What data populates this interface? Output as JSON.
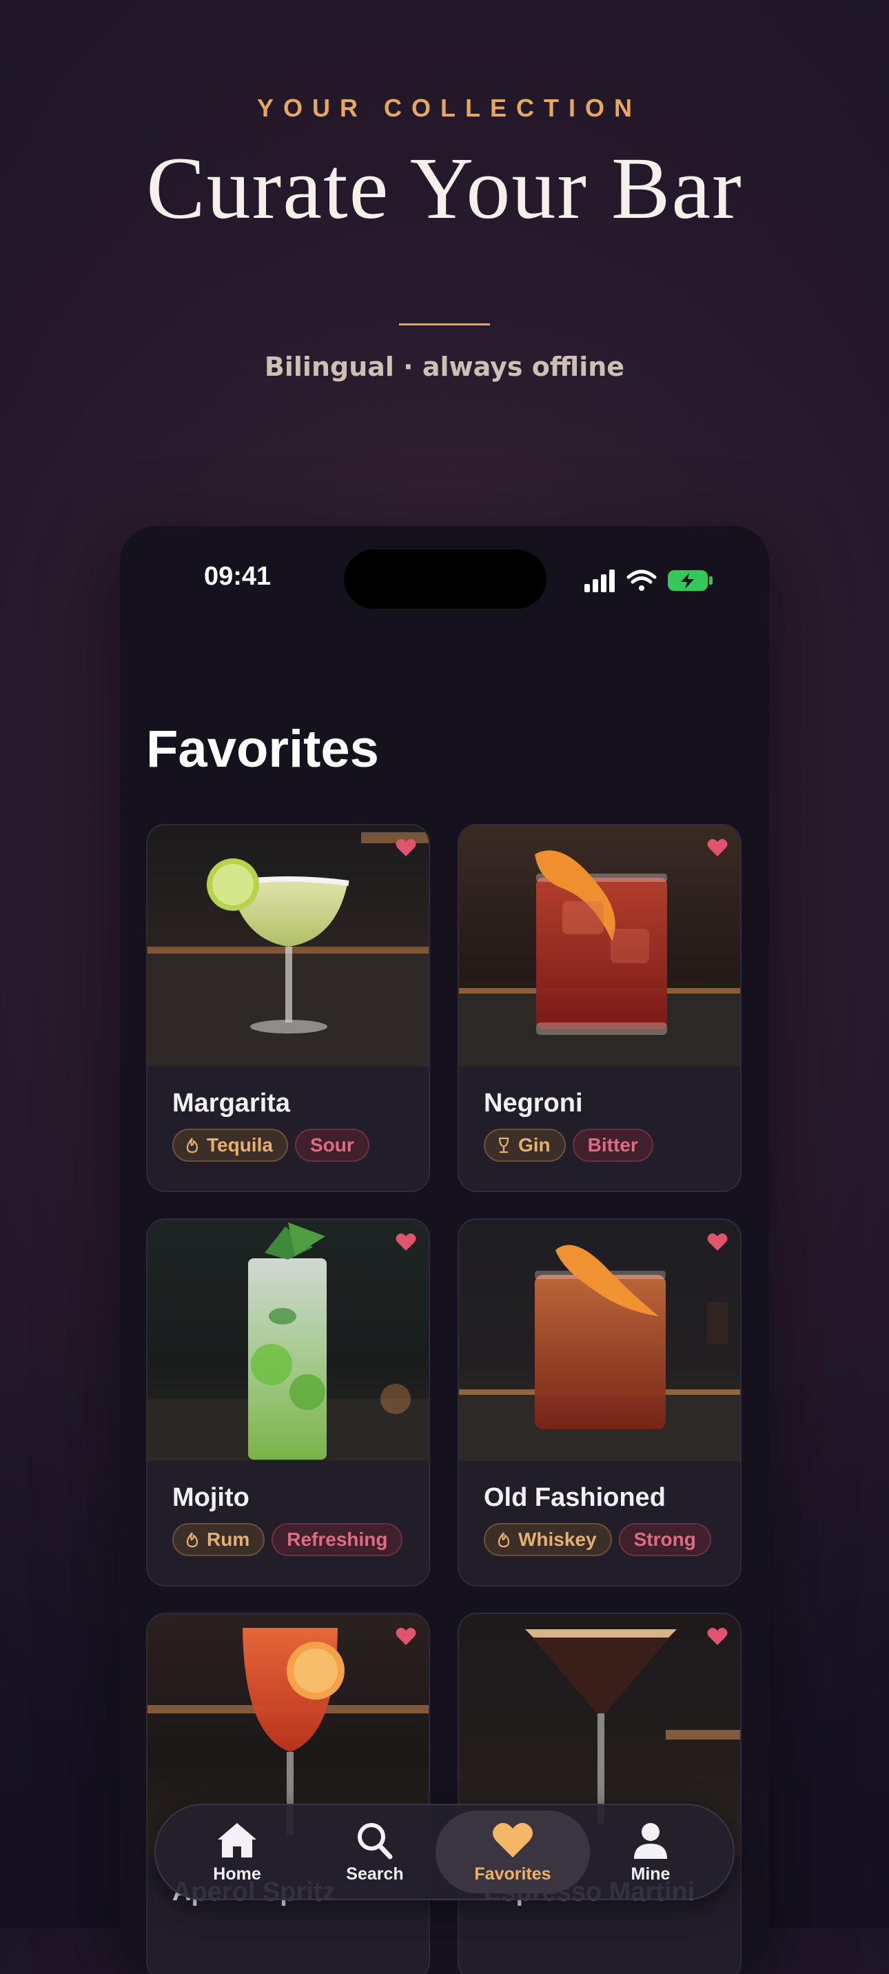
{
  "hero": {
    "eyebrow": "YOUR COLLECTION",
    "title": "Curate Your Bar",
    "subtitle": "Bilingual · always offline"
  },
  "status_bar": {
    "time": "09:41",
    "icons": [
      "signal-icon",
      "wifi-icon",
      "battery-charging-icon"
    ]
  },
  "screen": {
    "title": "Favorites"
  },
  "favorites": [
    {
      "name": "Margarita",
      "base": "Tequila",
      "base_icon": "flame-icon",
      "flavor": "Sour",
      "favorited": true
    },
    {
      "name": "Negroni",
      "base": "Gin",
      "base_icon": "glass-icon",
      "flavor": "Bitter",
      "favorited": true
    },
    {
      "name": "Mojito",
      "base": "Rum",
      "base_icon": "flame-icon",
      "flavor": "Refreshing",
      "favorited": true
    },
    {
      "name": "Old Fashioned",
      "base": "Whiskey",
      "base_icon": "flame-icon",
      "flavor": "Strong",
      "favorited": true
    },
    {
      "name": "Aperol Spritz",
      "favorited": true
    },
    {
      "name": "Espresso Martini",
      "favorited": true
    }
  ],
  "tabbar": {
    "tabs": [
      {
        "label": "Home",
        "icon": "home-icon"
      },
      {
        "label": "Search",
        "icon": "search-icon"
      },
      {
        "label": "Favorites",
        "icon": "heart-icon",
        "active": true
      },
      {
        "label": "Mine",
        "icon": "person-icon"
      }
    ]
  },
  "colors": {
    "accent": "#e7a85a",
    "flavor_tag": "#e06b85",
    "heart": "#e0546e",
    "phone_bg": "#15121d",
    "card_bg": "#211e2a"
  }
}
